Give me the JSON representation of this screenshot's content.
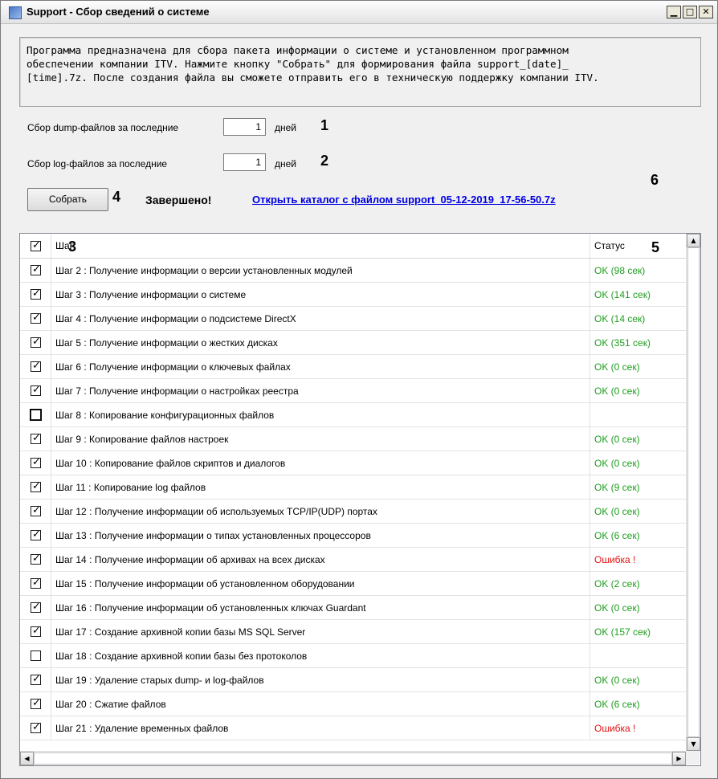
{
  "window": {
    "title": "Support - Сбор сведений о системе",
    "controls": {
      "minimize": "▁",
      "maximize": "□",
      "close": "✕"
    }
  },
  "description": "Программа предназначена для сбора пакета информации о системе и установленном программном\nобеспечении компании ITV. Нажмите кнопку \"Собрать\" для формирования файла support_[date]_\n[time].7z. После создания файла вы сможете отправить его в техническую поддержку компании ITV.",
  "dump": {
    "label": "Сбор dump-файлов за последние",
    "value": "1",
    "unit": "дней"
  },
  "log": {
    "label": "Сбор log-файлов за последние",
    "value": "1",
    "unit": "дней"
  },
  "callouts": {
    "c1": "1",
    "c2": "2",
    "c3": "3",
    "c4": "4",
    "c5": "5",
    "c6": "6"
  },
  "actions": {
    "collect_label": "Собрать",
    "status": "Завершено!",
    "open_link": "Открыть каталог с файлом support_05-12-2019_17-56-50.7z"
  },
  "list": {
    "header": {
      "step": "Шаг",
      "status": "Статус",
      "all_checked": true
    },
    "rows": [
      {
        "checked": true,
        "step": "Шаг 2 : Получение информации о версии установленных модулей",
        "status": "OK (98 сек)",
        "state": "ok"
      },
      {
        "checked": true,
        "step": "Шаг 3 : Получение информации о системе",
        "status": "OK (141 сек)",
        "state": "ok"
      },
      {
        "checked": true,
        "step": "Шаг 4 : Получение информации о подсистеме DirectX",
        "status": "OK (14 сек)",
        "state": "ok"
      },
      {
        "checked": true,
        "step": "Шаг 5 : Получение информации о жестких дисках",
        "status": "OK (351 сек)",
        "state": "ok"
      },
      {
        "checked": true,
        "step": "Шаг 6 : Получение информации о ключевых файлах",
        "status": "OK (0 сек)",
        "state": "ok"
      },
      {
        "checked": true,
        "step": "Шаг 7 : Получение информации о настройках реестра",
        "status": "OK (0 сек)",
        "state": "ok"
      },
      {
        "checked": false,
        "step": "Шаг 8 : Копирование конфигурационных файлов",
        "status": "",
        "state": "none",
        "focused": true
      },
      {
        "checked": true,
        "step": "Шаг 9 : Копирование файлов настроек",
        "status": "OK (0 сек)",
        "state": "ok"
      },
      {
        "checked": true,
        "step": "Шаг 10 : Копирование файлов скриптов и диалогов",
        "status": "OK (0 сек)",
        "state": "ok"
      },
      {
        "checked": true,
        "step": "Шаг 11 : Копирование log файлов",
        "status": "OK (9 сек)",
        "state": "ok"
      },
      {
        "checked": true,
        "step": "Шаг 12 : Получение информации об используемых TCP/IP(UDP) портах",
        "status": "OK (0 сек)",
        "state": "ok"
      },
      {
        "checked": true,
        "step": "Шаг 13 : Получение информации о типах установленных процессоров",
        "status": "OK (6 сек)",
        "state": "ok"
      },
      {
        "checked": true,
        "step": "Шаг 14 : Получение информации об архивах на всех дисках",
        "status": "Ошибка !",
        "state": "err"
      },
      {
        "checked": true,
        "step": "Шаг 15 : Получение информации об установленном оборудовании",
        "status": "OK (2 сек)",
        "state": "ok"
      },
      {
        "checked": true,
        "step": "Шаг 16 : Получение информации об установленных ключах Guardant",
        "status": "OK (0 сек)",
        "state": "ok"
      },
      {
        "checked": true,
        "step": "Шаг 17 : Создание архивной копии базы MS SQL Server",
        "status": "OK (157 сек)",
        "state": "ok"
      },
      {
        "checked": false,
        "step": "Шаг 18 : Создание архивной копии базы без протоколов",
        "status": "",
        "state": "none"
      },
      {
        "checked": true,
        "step": "Шаг 19 : Удаление старых dump- и log-файлов",
        "status": "OK (0 сек)",
        "state": "ok"
      },
      {
        "checked": true,
        "step": "Шаг 20 : Сжатие файлов",
        "status": "OK (6 сек)",
        "state": "ok"
      },
      {
        "checked": true,
        "step": "Шаг 21 : Удаление временных файлов",
        "status": "Ошибка !",
        "state": "err"
      }
    ]
  },
  "colors": {
    "ok": "#1e9e1e",
    "error": "#e81010",
    "link": "#0000e0"
  }
}
